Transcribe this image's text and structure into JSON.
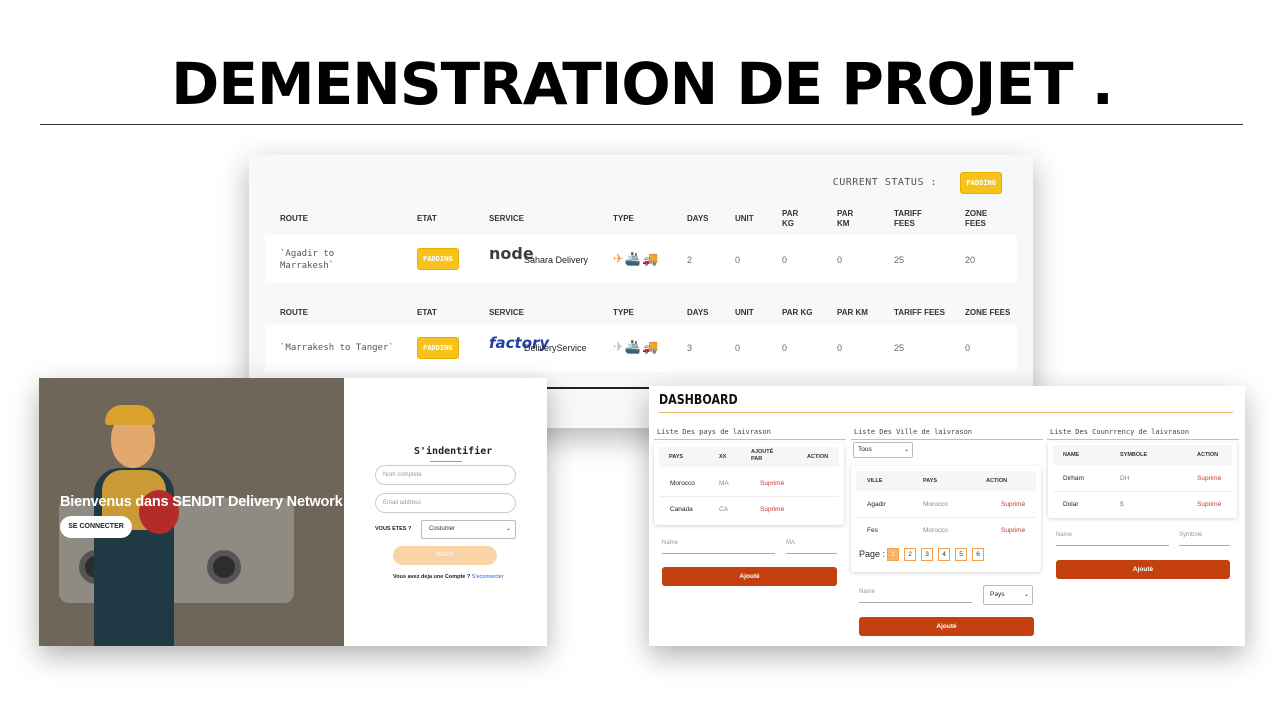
{
  "slide": {
    "title": "DEMENSTRATION DE PROJET ."
  },
  "status_panel": {
    "current_status_label": "CURRENT STATUS :",
    "current_status_badge": "PADDING",
    "rows": [
      {
        "headers": [
          "ROUTE",
          "ETAT",
          "SERVICE",
          "TYPE",
          "DAYS",
          "UNIT",
          "PAR\nKG",
          "PAR\nKM",
          "TARIFF\nFEES",
          "ZONE\nFEES"
        ],
        "route": "`Agadir to\nMarrakesh`",
        "etat": "PADDING",
        "service_logo": "node",
        "service_name": "Sahara Delivery",
        "type_icons": "✈🚢🚚",
        "days": "2",
        "unit": "0",
        "par_kg": "0",
        "par_km": "0",
        "tariff_fees": "25",
        "zone_fees": "20"
      },
      {
        "headers": [
          "ROUTE",
          "ETAT",
          "SERVICE",
          "TYPE",
          "DAYS",
          "UNIT",
          "PAR KG",
          "PAR KM",
          "TARIFF FEES",
          "ZONE FEES"
        ],
        "route": "`Marrakesh to Tanger`",
        "etat": "PADDING",
        "service_logo": "factory",
        "service_name": "DeliveryService",
        "type_icons": "✈🚢🚚",
        "days": "3",
        "unit": "0",
        "par_kg": "0",
        "par_km": "0",
        "tariff_fees": "25",
        "zone_fees": "0"
      }
    ]
  },
  "login_panel": {
    "hero_title": "Bienvenus dans SENDIT Delivery Network",
    "se_connecter": "SE CONNECTER",
    "form_title": "S'indentifier",
    "nom_placeholder": "Nom complete",
    "email_placeholder": "Email address",
    "vous_etes_label": "VOUS ETES ?",
    "vous_etes_value": "Costumer",
    "submit_label": "PROFIT",
    "account_text": "Vous avez deja une Compte ?",
    "account_link": "S'econnecter"
  },
  "dashboard": {
    "title": "DASHBOARD",
    "pays": {
      "title": "Liste Des pays de laivrason",
      "headers": [
        "PAYS",
        "XX",
        "AJOUTÉ\nPAR",
        "ACTION"
      ],
      "rows": [
        {
          "pays": "Morocco",
          "code": "MA",
          "action": "Suprimé"
        },
        {
          "pays": "Canada",
          "code": "CA",
          "action": "Suprimé"
        }
      ],
      "name_placeholder": "Name",
      "code_placeholder": "MA",
      "button": "Ajouté"
    },
    "ville": {
      "title": "Liste Des Ville de laivrason",
      "filter_value": "Tous",
      "headers": [
        "VILLE",
        "PAYS",
        "ACTION"
      ],
      "rows": [
        {
          "ville": "Agadir",
          "pays": "Morocco",
          "action": "Suprimé"
        },
        {
          "ville": "Fes",
          "pays": "Morocco",
          "action": "Suprimé"
        }
      ],
      "page_label": "Page :",
      "pages": [
        "1",
        "2",
        "3",
        "4",
        "5",
        "6"
      ],
      "name_placeholder": "Name",
      "pays_select": "Pays",
      "button": "Ajouté"
    },
    "currency": {
      "title": "Liste Des Counrrency de laivrason",
      "headers": [
        "NAME",
        "SYMBOLE",
        "ACTION"
      ],
      "rows": [
        {
          "name": "Dirham",
          "symbole": "DH",
          "action": "Suprimé"
        },
        {
          "name": "Dolar",
          "symbole": "$",
          "action": "Suprimé"
        }
      ],
      "name_placeholder": "Name",
      "symbole_placeholder": "Symbole",
      "button": "Ajouté"
    }
  },
  "colors": {
    "badge": "#f7c21b",
    "accent": "#c4400f",
    "delete": "#c43a2a"
  }
}
